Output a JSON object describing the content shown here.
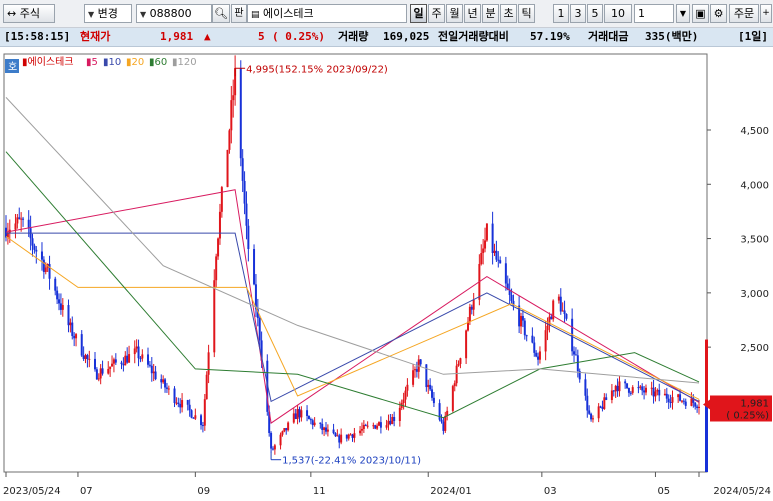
{
  "toolbar": {
    "market_select": "주식",
    "mode_select": "변경",
    "code_input": "088800",
    "badge_label": "판",
    "name_field": "에이스테크",
    "period_buttons": [
      "일",
      "주",
      "월",
      "년",
      "분",
      "초",
      "틱"
    ],
    "interval_buttons": [
      "1",
      "3",
      "5",
      "10"
    ],
    "count_value": "1",
    "order_label": "주문"
  },
  "info": {
    "time": "[15:58:15]",
    "price_label": "현재가",
    "price": "1,981",
    "change_arrow": "▲",
    "change": "5",
    "change_pct": "( 0.25%)",
    "volume_label": "거래량",
    "volume": "169,025",
    "prev_volume_label": "전일거래량대비",
    "prev_volume_pct": "57.19%",
    "amount_label": "거래대금",
    "amount": "335(백만)",
    "period_tag": "[1일]"
  },
  "legend": {
    "badge": "호",
    "name": "에이스테크",
    "ma": [
      {
        "label": "5",
        "color": "#d81b60"
      },
      {
        "label": "10",
        "color": "#3949ab"
      },
      {
        "label": "20",
        "color": "#f5a623"
      },
      {
        "label": "60",
        "color": "#2e7d32"
      },
      {
        "label": "120",
        "color": "#9e9e9e"
      }
    ]
  },
  "annotations": {
    "high": "4,995(152.15% 2023/09/22)",
    "low": "1,537(-22.41% 2023/10/11)"
  },
  "colors": {
    "up": "#e0151b",
    "down": "#1731d8",
    "ma5": "#d81b60",
    "ma10": "#3949ab",
    "ma20": "#f5a623",
    "ma60": "#2e7d32",
    "ma120": "#9e9e9e",
    "price_tag_bg": "#e0151b"
  },
  "chart_data": {
    "type": "candlestick",
    "y_ticks": [
      "4,500",
      "4,000",
      "3,500",
      "3,000",
      "2,500"
    ],
    "ylim": [
      1350,
      5200
    ],
    "x_ticks": [
      "2023/05/24",
      "07",
      "09",
      "11",
      "2024/01",
      "03",
      "05",
      "2024/05/24"
    ],
    "current_price_tag": [
      "1,981",
      "( 0.25%)"
    ],
    "price_keypoints": [
      {
        "date": "2023/05/24",
        "price": 3600
      },
      {
        "date": "2023/06/01",
        "price": 3650
      },
      {
        "date": "2023/06/15",
        "price": 3200
      },
      {
        "date": "2023/06/26",
        "price": 2700
      },
      {
        "date": "2023/07/10",
        "price": 2250
      },
      {
        "date": "2023/08/01",
        "price": 2450
      },
      {
        "date": "2023/08/20",
        "price": 2050
      },
      {
        "date": "2023/09/05",
        "price": 1800
      },
      {
        "date": "2023/09/12",
        "price": 3400
      },
      {
        "date": "2023/09/22",
        "price": 4995
      },
      {
        "date": "2023/09/28",
        "price": 3550
      },
      {
        "date": "2023/10/05",
        "price": 2600
      },
      {
        "date": "2023/10/11",
        "price": 1537
      },
      {
        "date": "2023/10/25",
        "price": 1900
      },
      {
        "date": "2023/11/15",
        "price": 1650
      },
      {
        "date": "2023/12/15",
        "price": 1850
      },
      {
        "date": "2023/12/28",
        "price": 2350
      },
      {
        "date": "2024/01/10",
        "price": 1750
      },
      {
        "date": "2024/01/25",
        "price": 2900
      },
      {
        "date": "2024/02/02",
        "price": 3550
      },
      {
        "date": "2024/02/15",
        "price": 2900
      },
      {
        "date": "2024/02/29",
        "price": 2400
      },
      {
        "date": "2024/03/10",
        "price": 3000
      },
      {
        "date": "2024/03/20",
        "price": 2400
      },
      {
        "date": "2024/03/28",
        "price": 1800
      },
      {
        "date": "2024/04/10",
        "price": 2150
      },
      {
        "date": "2024/05/24",
        "price": 1981
      }
    ],
    "moving_averages": [
      {
        "name": "5",
        "points": [
          {
            "date": "2023/05/24",
            "price": 3560
          },
          {
            "date": "2023/09/22",
            "price": 3950
          },
          {
            "date": "2023/10/11",
            "price": 1800
          },
          {
            "date": "2024/02/02",
            "price": 3150
          },
          {
            "date": "2024/05/24",
            "price": 1990
          }
        ]
      },
      {
        "name": "10",
        "points": [
          {
            "date": "2023/05/24",
            "price": 3550
          },
          {
            "date": "2023/09/22",
            "price": 3550
          },
          {
            "date": "2023/10/11",
            "price": 2000
          },
          {
            "date": "2024/02/02",
            "price": 3000
          },
          {
            "date": "2024/05/24",
            "price": 2000
          }
        ]
      },
      {
        "name": "20",
        "points": [
          {
            "date": "2023/05/24",
            "price": 3520
          },
          {
            "date": "2023/07/01",
            "price": 3050
          },
          {
            "date": "2023/09/28",
            "price": 3050
          },
          {
            "date": "2023/10/25",
            "price": 2050
          },
          {
            "date": "2024/02/15",
            "price": 2900
          },
          {
            "date": "2024/05/24",
            "price": 2020
          }
        ]
      },
      {
        "name": "60",
        "points": [
          {
            "date": "2023/05/24",
            "price": 4300
          },
          {
            "date": "2023/09/01",
            "price": 2300
          },
          {
            "date": "2023/10/25",
            "price": 2250
          },
          {
            "date": "2024/01/10",
            "price": 1850
          },
          {
            "date": "2024/03/01",
            "price": 2300
          },
          {
            "date": "2024/04/20",
            "price": 2450
          },
          {
            "date": "2024/05/24",
            "price": 2180
          }
        ]
      },
      {
        "name": "120",
        "points": [
          {
            "date": "2023/05/24",
            "price": 4800
          },
          {
            "date": "2023/08/15",
            "price": 3250
          },
          {
            "date": "2023/10/25",
            "price": 2700
          },
          {
            "date": "2024/01/10",
            "price": 2250
          },
          {
            "date": "2024/03/01",
            "price": 2300
          },
          {
            "date": "2024/05/24",
            "price": 2170
          }
        ]
      }
    ],
    "volume_range": {
      "date_start": "2023/05/24",
      "date_end": "2024/05/24"
    }
  }
}
